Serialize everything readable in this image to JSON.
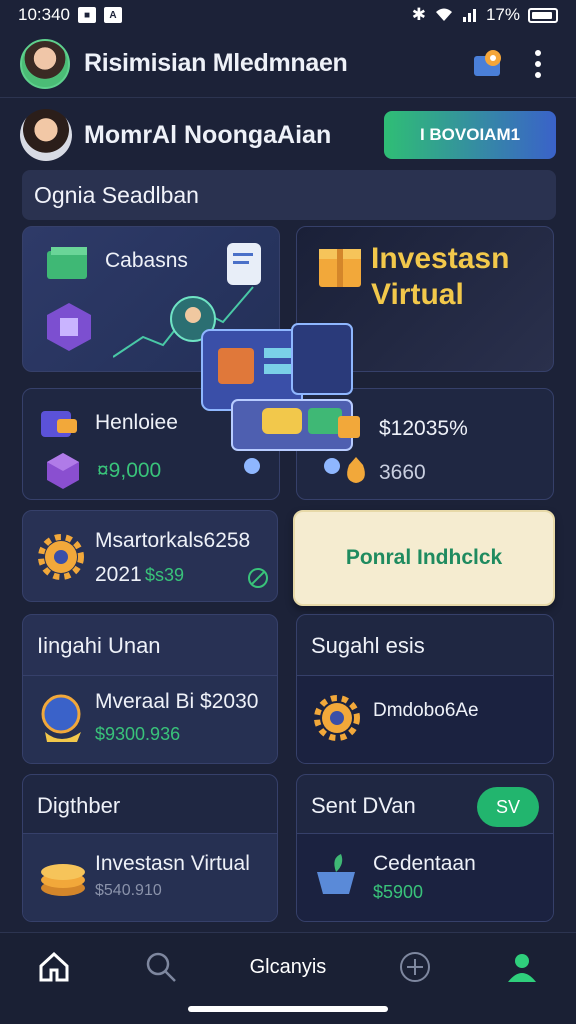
{
  "status_bar": {
    "time": "10:340",
    "app_badge": "A",
    "battery": "17%"
  },
  "app_bar": {
    "title": "Risimisian Mledmnaen"
  },
  "profile": {
    "name": "MomrAl NoongaAian",
    "cta_label": "I BOVOIAM1"
  },
  "search": {
    "text": "Ognia Seadlban"
  },
  "hero": {
    "left_label": "Cabasns",
    "right_title_line1": "Investasn",
    "right_title_line2": "Virtual"
  },
  "stats": {
    "left_label": "Henloiee",
    "left_value": "¤9,000",
    "right_label": "$12035%",
    "right_value": "3660"
  },
  "promo": {
    "title": "Msartorkals6258",
    "year": "2021",
    "amount": "$s39",
    "button_label": "Ponral Indhclck"
  },
  "sections": [
    {
      "header": "Iingahi Unan",
      "item_title": "Mveraal Bi $2030",
      "item_value": "$9300.936"
    },
    {
      "header": "Sugahl esis",
      "item_title": "Dmdobo6Ae",
      "item_value": ""
    },
    {
      "header": "Digthber",
      "item_title": "Investasn Virtual",
      "item_value": "$540.910"
    },
    {
      "header": "Sent DVan",
      "pill": "SV",
      "item_title": "Cedentaan",
      "item_value": "$5900"
    }
  ],
  "bottom_nav": {
    "center_label": "Glcanyis"
  },
  "colors": {
    "accent_green": "#39c37a",
    "gold": "#f2c84b",
    "background": "#1c2238"
  }
}
